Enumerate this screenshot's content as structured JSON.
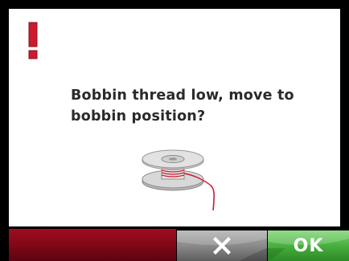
{
  "dialog": {
    "message": "Bobbin thread low, move to bobbin position?",
    "warning_icon": "exclamation-icon",
    "illustration": "bobbin-icon"
  },
  "footer": {
    "cancel_icon": "close-icon",
    "ok_label": "OK"
  },
  "colors": {
    "warning": "#cc1a2e",
    "thread": "#cc1a2e",
    "dismiss_bar": "#840818",
    "cancel": "#8a8a8a",
    "ok": "#48b03e",
    "dialog_bg": "#ffffff",
    "text": "#2a2a2a"
  }
}
